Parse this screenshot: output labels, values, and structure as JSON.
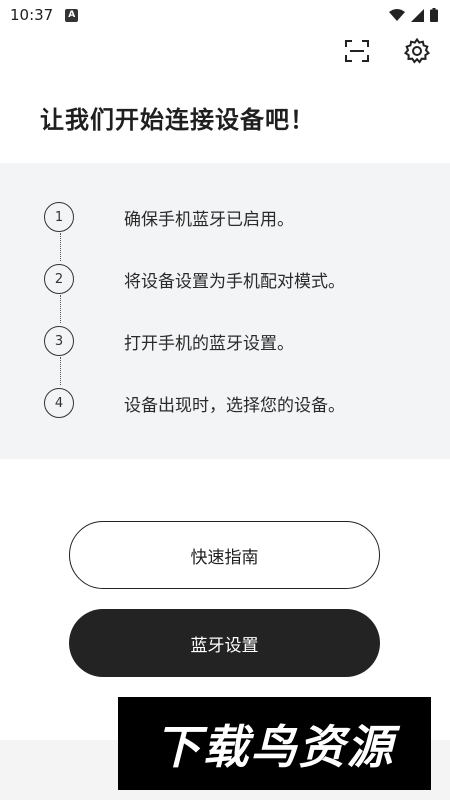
{
  "status_bar": {
    "time": "10:37",
    "notification_letter": "A"
  },
  "header": {
    "title": "让我们开始连接设备吧！"
  },
  "steps": [
    {
      "number": "1",
      "text": "确保手机蓝牙已启用。"
    },
    {
      "number": "2",
      "text": "将设备设置为手机配对模式。"
    },
    {
      "number": "3",
      "text": "打开手机的蓝牙设置。"
    },
    {
      "number": "4",
      "text": "设备出现时，选择您的设备。"
    }
  ],
  "buttons": {
    "quick_guide": "快速指南",
    "bluetooth_settings": "蓝牙设置"
  },
  "watermark": {
    "text": "下载鸟资源"
  },
  "colors": {
    "panel_bg": "#f3f4f6",
    "button_dark": "#232323",
    "text_primary": "#1f1f1f"
  }
}
